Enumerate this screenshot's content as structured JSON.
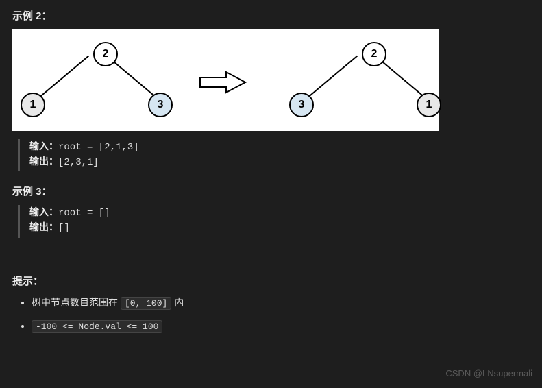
{
  "example2": {
    "heading": "示例 2：",
    "tree_left": {
      "root": "2",
      "left": "1",
      "right": "3"
    },
    "tree_right": {
      "root": "2",
      "left": "3",
      "right": "1"
    },
    "input_label": "输入：",
    "input_value": "root = [2,1,3]",
    "output_label": "输出：",
    "output_value": "[2,3,1]"
  },
  "example3": {
    "heading": "示例 3：",
    "input_label": "输入：",
    "input_value": "root = []",
    "output_label": "输出：",
    "output_value": "[]"
  },
  "hints": {
    "heading": "提示：",
    "items": [
      {
        "prefix": "树中节点数目范围在 ",
        "code": "[0, 100]",
        "suffix": " 内"
      },
      {
        "prefix": "",
        "code": "-100 <= Node.val <= 100",
        "suffix": ""
      }
    ]
  },
  "watermark": "CSDN @LNsupermali"
}
